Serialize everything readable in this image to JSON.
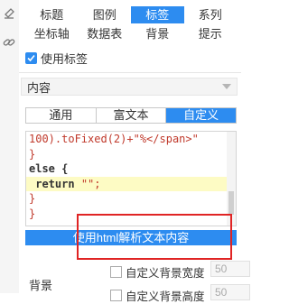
{
  "tabs_row1": [
    "标题",
    "图例",
    "标签",
    "系列"
  ],
  "tabs_row2": [
    "坐标轴",
    "数据表",
    "背景",
    "提示"
  ],
  "active_tab": "标签",
  "use_label": {
    "label": "使用标签",
    "checked": true
  },
  "content_select": {
    "value": "内容"
  },
  "subtabs": [
    "通用",
    "富文本",
    "自定义"
  ],
  "active_subtab": "自定义",
  "code": {
    "line1": "100).toFixed(2)+\"%</span>\"",
    "line2": "}",
    "line3": "else {",
    "line4_kw": "return",
    "line4_str": "\"\";",
    "line5": "}",
    "line6": "}"
  },
  "parse_button": "使用html解析文本内容",
  "bottom": {
    "section_label": "背景",
    "custom_bg_width": {
      "label": "自定义背景宽度",
      "value": "50"
    },
    "custom_bg_height": {
      "label": "自定义背景高度",
      "value": "50"
    }
  },
  "colors": {
    "accent": "#2d8cf0",
    "highlight_box": "#e02424",
    "code_highlight": "#fdfbc4"
  }
}
